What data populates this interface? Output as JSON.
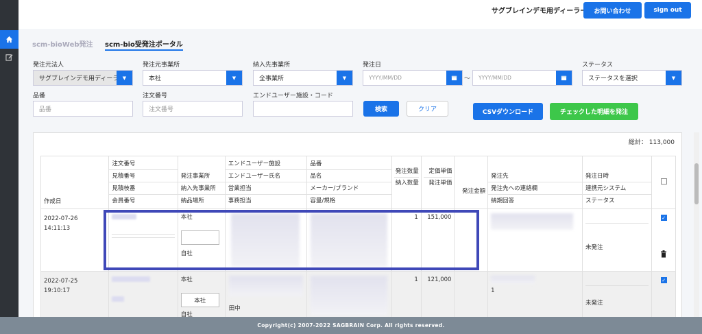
{
  "header": {
    "dealer_name": "サグブレインデモ用ディーラー",
    "contact_button": "お問い合わせ",
    "signout_button": "sign out"
  },
  "tabs": [
    {
      "label": "scm-bioWeb発注",
      "active": false
    },
    {
      "label": "scm-bio受発注ポータル",
      "active": true
    }
  ],
  "filters": {
    "orderer_label": "発注元法人",
    "orderer_value": "サグブレインデモ用ディーラ",
    "orderer_office_label": "発注元事業所",
    "orderer_office_value": "本社",
    "delivery_office_label": "納入先事業所",
    "delivery_office_value": "全事業所",
    "order_date_label": "発注日",
    "date_from_placeholder": "YYYY/MM/DD",
    "date_sep": "〜",
    "date_to_placeholder": "YYYY/MM/DD",
    "status_label": "ステータス",
    "status_value": "ステータスを選択",
    "product_no_label": "品番",
    "product_no_placeholder": "品番",
    "order_no_label": "注文番号",
    "order_no_placeholder": "注文番号",
    "enduser_label": "エンドユーザー施設・コード",
    "search_button": "検索",
    "clear_button": "クリア",
    "csv_button": "CSVダウンロード",
    "order_checked_button": "チェックした明細を発注"
  },
  "table": {
    "total_label": "総計：",
    "total_value": "113,000",
    "headers": {
      "created": "作成日",
      "order_col": [
        "注文番号",
        "見積番号",
        "見積枝番",
        "会員番号"
      ],
      "office_col": [
        "発注事業所",
        "納入先事業所",
        "納品場所"
      ],
      "enduser_col": [
        "エンドユーザー施設",
        "エンドユーザー氏名",
        "営業担当",
        "事務担当"
      ],
      "product_col": [
        "品番",
        "品名",
        "メーカー/ブランド",
        "容量/規格"
      ],
      "qty_col": [
        "発注数量",
        "納入数量"
      ],
      "price_col": [
        "定価単価",
        "発注単価"
      ],
      "amount": "発注金額",
      "supplier_col": [
        "発注先",
        "発注先への連絡欄",
        "納期回答"
      ],
      "date_col": [
        "発注日時",
        "連携元システム",
        "ステータス"
      ]
    },
    "rows": [
      {
        "created_date": "2022-07-26",
        "created_time": "14:11:13",
        "office": "本社",
        "delivery": "",
        "place": "自社",
        "qty": "1",
        "price": "151,000",
        "status": "未発注",
        "checked": true
      },
      {
        "created_date": "2022-07-25",
        "created_time": "19:10:17",
        "office": "本社",
        "delivery": "本社",
        "place": "自社",
        "clerk": "田中",
        "qty": "1",
        "price": "121,000",
        "supplier_note": "1",
        "status": "未発注",
        "checked": true
      }
    ]
  },
  "footer": "Copyright(c) 2007-2022 SAGBRAIN Corp. All rights reserved."
}
